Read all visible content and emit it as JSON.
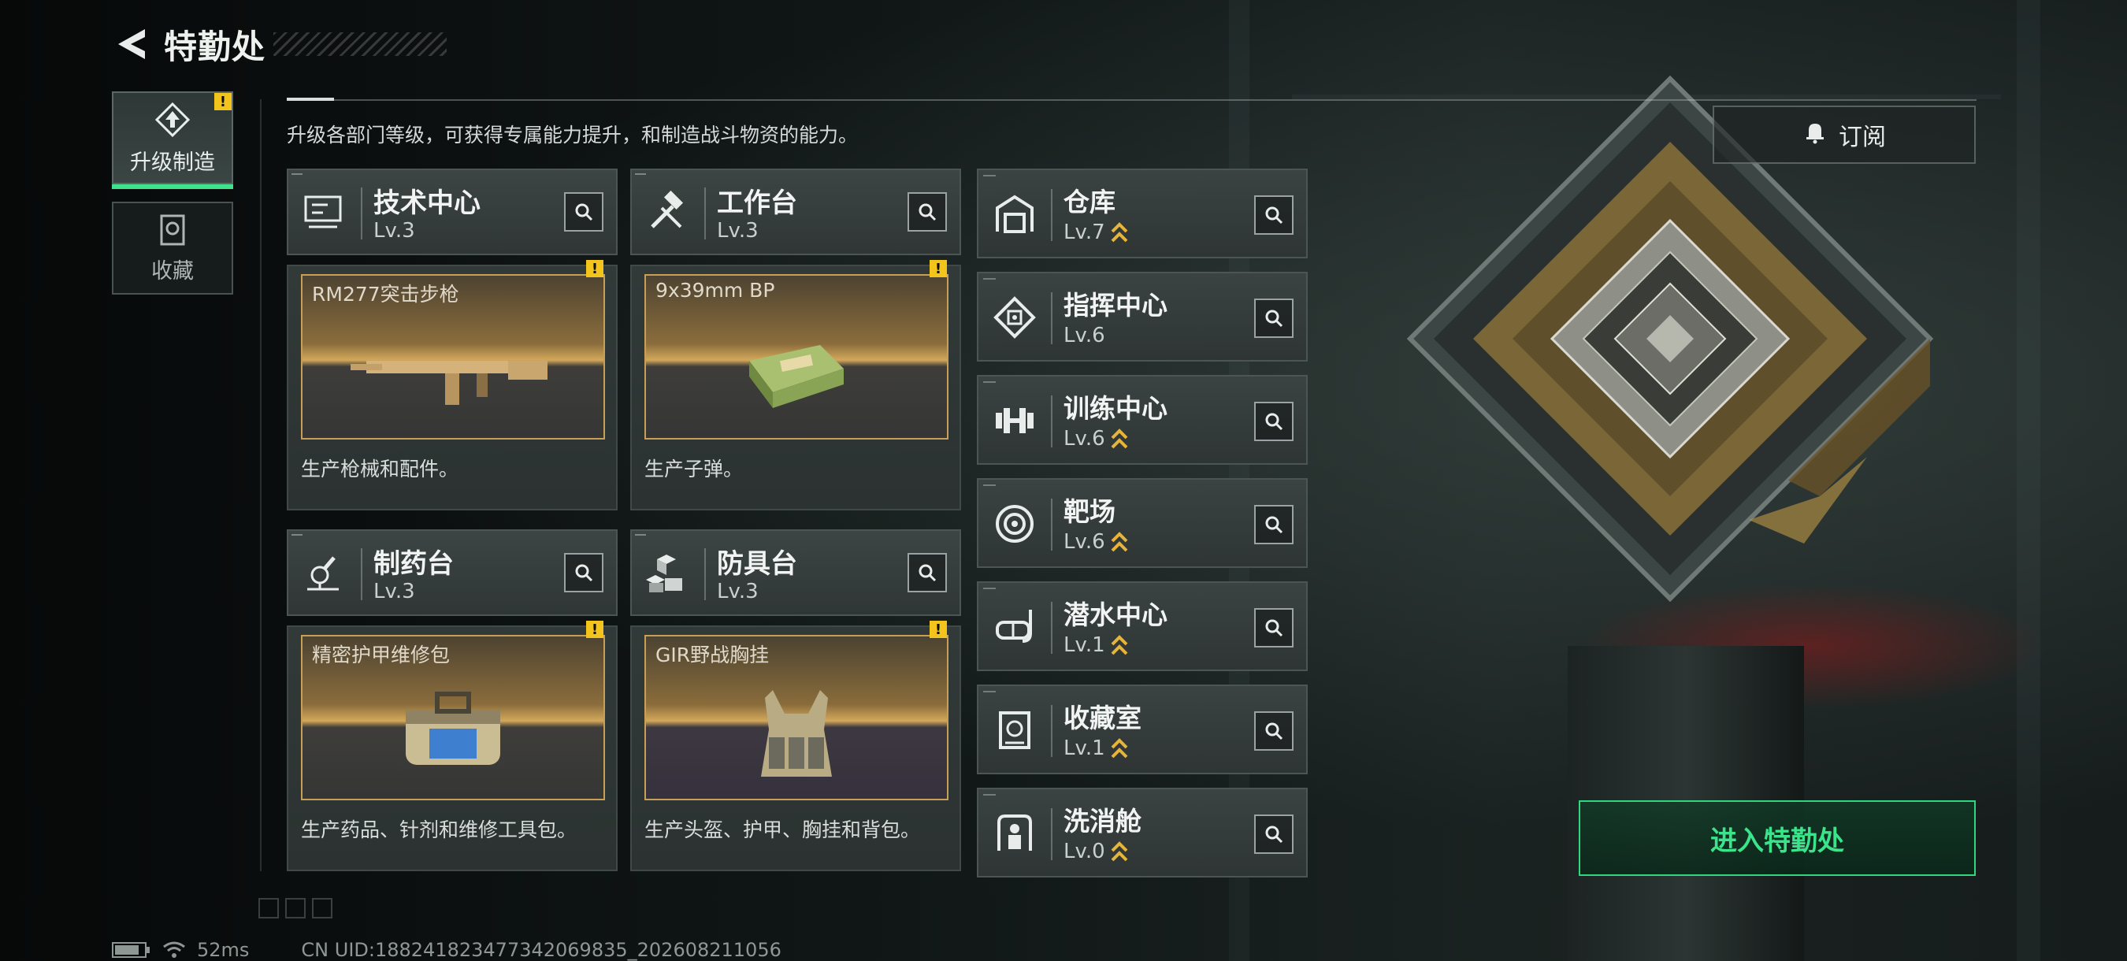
{
  "header": {
    "title": "特勤处"
  },
  "sidebar": {
    "tabs": [
      {
        "label": "升级制造",
        "active": true,
        "alert": "!"
      },
      {
        "label": "收藏",
        "active": false
      }
    ]
  },
  "description": "升级各部门等级，可获得专属能力提升，和制造战斗物资的能力。",
  "subscribe": {
    "label": "订阅",
    "icon": "bell-icon"
  },
  "enter_button": {
    "label": "进入特勤处"
  },
  "production": [
    {
      "name": "技术中心",
      "level": "Lv.3",
      "icon": "tech-center-icon",
      "item": {
        "name": "RM277突击步枪",
        "alert": "!",
        "icon": "rifle-icon"
      },
      "product": "生产枪械和配件。"
    },
    {
      "name": "工作台",
      "level": "Lv.3",
      "icon": "hammer-wrench-icon",
      "item": {
        "name": "9x39mm BP",
        "alert": "!",
        "icon": "ammo-box-icon"
      },
      "product": "生产子弹。"
    },
    {
      "name": "制药台",
      "level": "Lv.3",
      "icon": "microscope-icon",
      "item": {
        "name": "精密护甲维修包",
        "alert": "!",
        "icon": "repair-kit-icon"
      },
      "product": "生产药品、针剂和维修工具包。"
    },
    {
      "name": "防具台",
      "level": "Lv.3",
      "icon": "armor-blocks-icon",
      "item": {
        "name": "GIR野战胸挂",
        "alert": "!",
        "icon": "chest-rig-icon"
      },
      "product": "生产头盔、护甲、胸挂和背包。"
    }
  ],
  "facilities": [
    {
      "name": "仓库",
      "level": "Lv.7",
      "upgradable": true,
      "icon": "warehouse-icon"
    },
    {
      "name": "指挥中心",
      "level": "Lv.6",
      "upgradable": false,
      "icon": "command-chip-icon"
    },
    {
      "name": "训练中心",
      "level": "Lv.6",
      "upgradable": true,
      "icon": "dumbbell-icon"
    },
    {
      "name": "靶场",
      "level": "Lv.6",
      "upgradable": true,
      "icon": "target-icon"
    },
    {
      "name": "潜水中心",
      "level": "Lv.1",
      "upgradable": true,
      "icon": "diving-mask-icon"
    },
    {
      "name": "收藏室",
      "level": "Lv.1",
      "upgradable": true,
      "icon": "collection-icon"
    },
    {
      "name": "洗消舱",
      "level": "Lv.0",
      "upgradable": true,
      "icon": "decon-chamber-icon"
    }
  ],
  "status_bar": {
    "ping": "52ms",
    "uid": "CN UID:18824182347734​2069835_202608211056"
  },
  "colors": {
    "accent_green": "#3be38b",
    "alert_yellow": "#f3c51c",
    "upgrade_gold": "#e6b43a",
    "item_border": "#c7a055"
  }
}
